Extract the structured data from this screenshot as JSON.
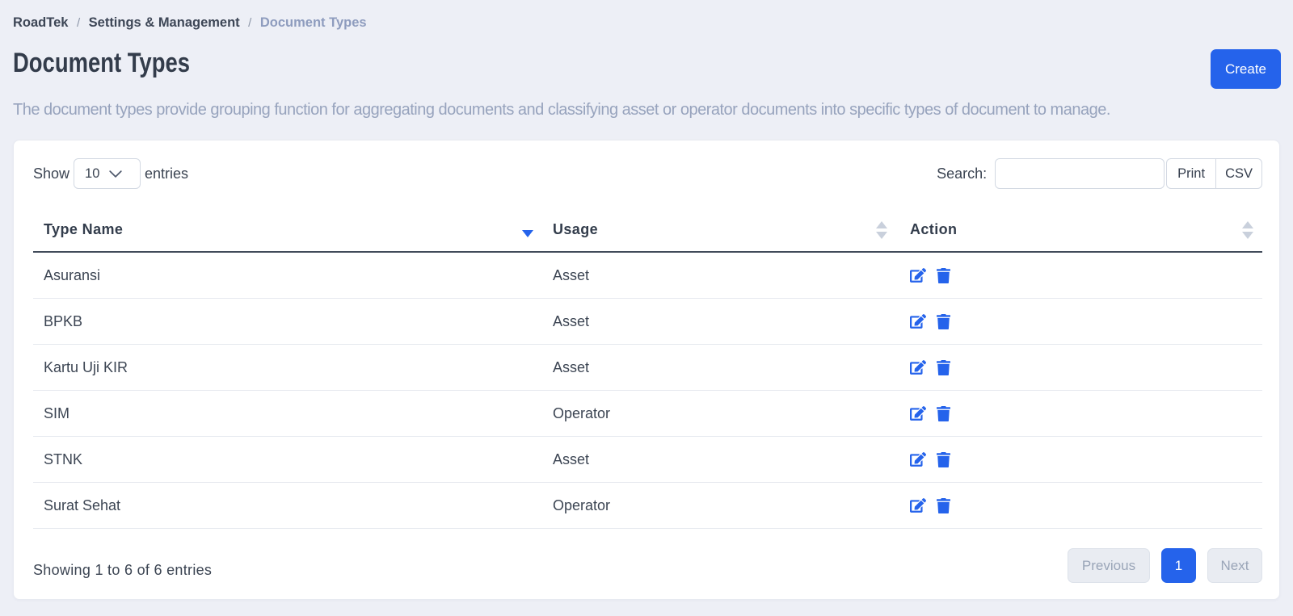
{
  "colors": {
    "primary": "#2563eb",
    "page_background": "#edeff6",
    "card_background": "#ffffff",
    "muted_text": "#97a3bd",
    "dark_text": "#3b4452"
  },
  "breadcrumb": {
    "items": [
      {
        "label": "RoadTek",
        "active": false
      },
      {
        "label": "Settings & Management",
        "active": false
      },
      {
        "label": "Document Types",
        "active": true
      }
    ],
    "separator": "/"
  },
  "header": {
    "title": "Document Types",
    "create_label": "Create",
    "description": "The document types provide grouping function for aggregating documents and classifying asset or operator documents into specific types of document to manage."
  },
  "toolbar": {
    "show_label": "Show",
    "page_size": "10",
    "entries_label": "entries",
    "search_label": "Search:",
    "search_value": "",
    "print_label": "Print",
    "csv_label": "CSV"
  },
  "table": {
    "columns": [
      {
        "label": "Type Name",
        "sort": "desc"
      },
      {
        "label": "Usage",
        "sort": "none"
      },
      {
        "label": "Action",
        "sort": "none"
      }
    ],
    "rows": [
      {
        "type_name": "Asuransi",
        "usage": "Asset"
      },
      {
        "type_name": "BPKB",
        "usage": "Asset"
      },
      {
        "type_name": "Kartu Uji KIR",
        "usage": "Asset"
      },
      {
        "type_name": "SIM",
        "usage": "Operator"
      },
      {
        "type_name": "STNK",
        "usage": "Asset"
      },
      {
        "type_name": "Surat Sehat",
        "usage": "Operator"
      }
    ]
  },
  "footer": {
    "info": "Showing 1 to 6 of 6 entries",
    "pagination": {
      "previous_label": "Previous",
      "active_page": "1",
      "next_label": "Next"
    }
  }
}
